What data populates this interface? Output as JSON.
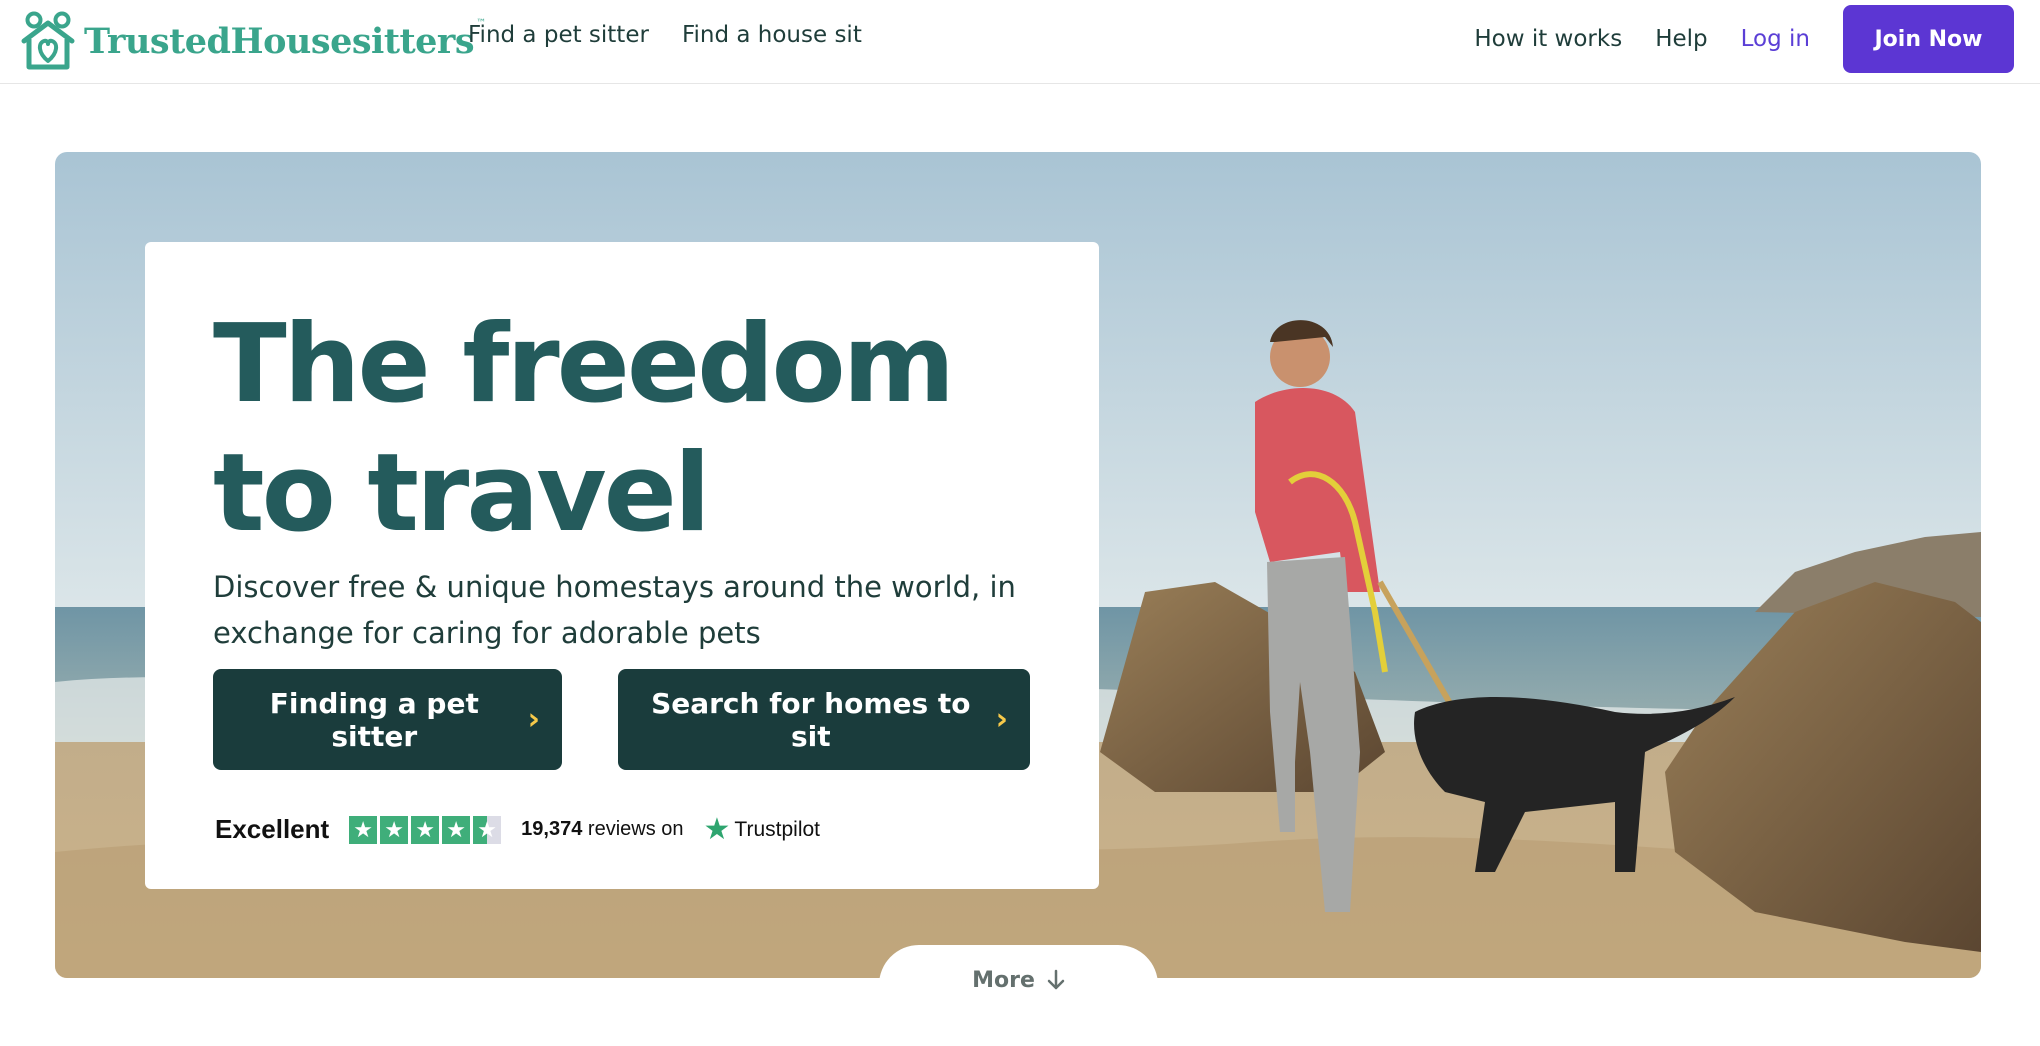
{
  "header": {
    "brand": "TrustedHousesitters",
    "trademark": "™",
    "nav_left": [
      "Find a pet sitter",
      "Find a house sit"
    ],
    "nav_right": {
      "how_it_works": "How it works",
      "help": "Help",
      "login": "Log in",
      "join": "Join Now"
    }
  },
  "hero": {
    "title": "The freedom to travel",
    "subtitle": "Discover free & unique homestays around the world, in exchange for caring for adorable pets",
    "cta_primary": "Finding a pet sitter",
    "cta_secondary": "Search for homes to sit",
    "trustpilot": {
      "rating_word": "Excellent",
      "stars": 4.5,
      "reviews": "19,374",
      "reviews_suffix": "reviews on",
      "brand": "Trustpilot"
    },
    "more": "More",
    "image_alt": "Man walking a dog on a rocky beach"
  },
  "colors": {
    "brand_green": "#3aa58c",
    "title_teal": "#245b5c",
    "cta_dark": "#1a3c3c",
    "join_purple": "#5c36d3",
    "login_purple": "#5b3fd6",
    "chevron_yellow": "#f6c94a",
    "trustpilot_green": "#3fae7a"
  },
  "icons": {
    "logo": "house-paws-icon",
    "cta_chevron": "chevron-right-icon",
    "more": "arrow-down-icon",
    "rating": "star-icon"
  }
}
